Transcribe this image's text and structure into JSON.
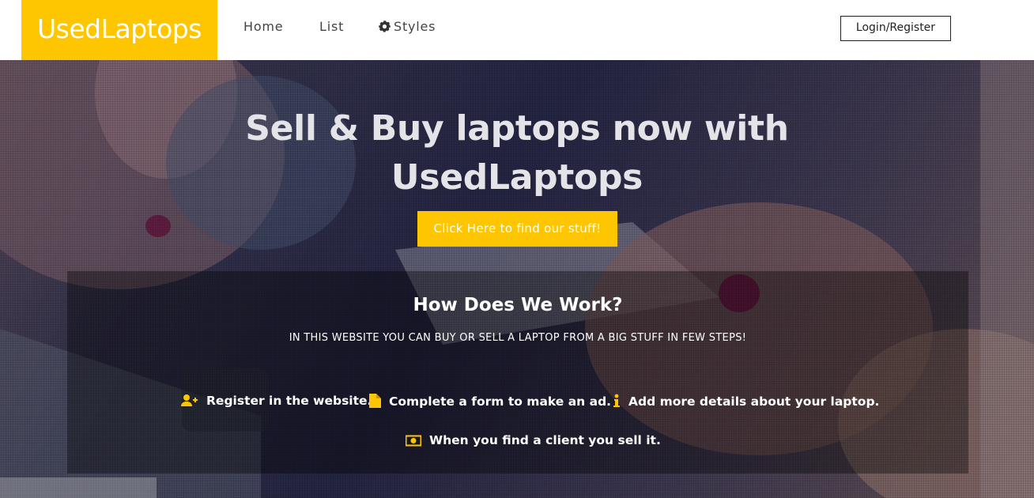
{
  "brand": {
    "name": "UsedLaptops",
    "color": "#fdc600"
  },
  "nav": {
    "home": "Home",
    "list": "List",
    "styles": "Styles",
    "styles_icon": "gear-icon",
    "login": "Login/Register"
  },
  "hero": {
    "title": "Sell & Buy laptops now with UsedLaptops",
    "cta": "Click Here to find our stuff!"
  },
  "how": {
    "title": "How Does We Work?",
    "subtitle": "IN THIS WEBSITE YOU CAN BUY OR SELL A LAPTOP FROM A BIG STUFF IN FEW STEPS!",
    "steps": [
      {
        "icon": "user-plus-icon",
        "text": "Register in the website."
      },
      {
        "icon": "file-icon",
        "text": "Complete a form to make an ad."
      },
      {
        "icon": "info-icon",
        "text": "Add more details about your laptop."
      },
      {
        "icon": "money-icon",
        "text": "When you find a client you sell it."
      }
    ]
  }
}
